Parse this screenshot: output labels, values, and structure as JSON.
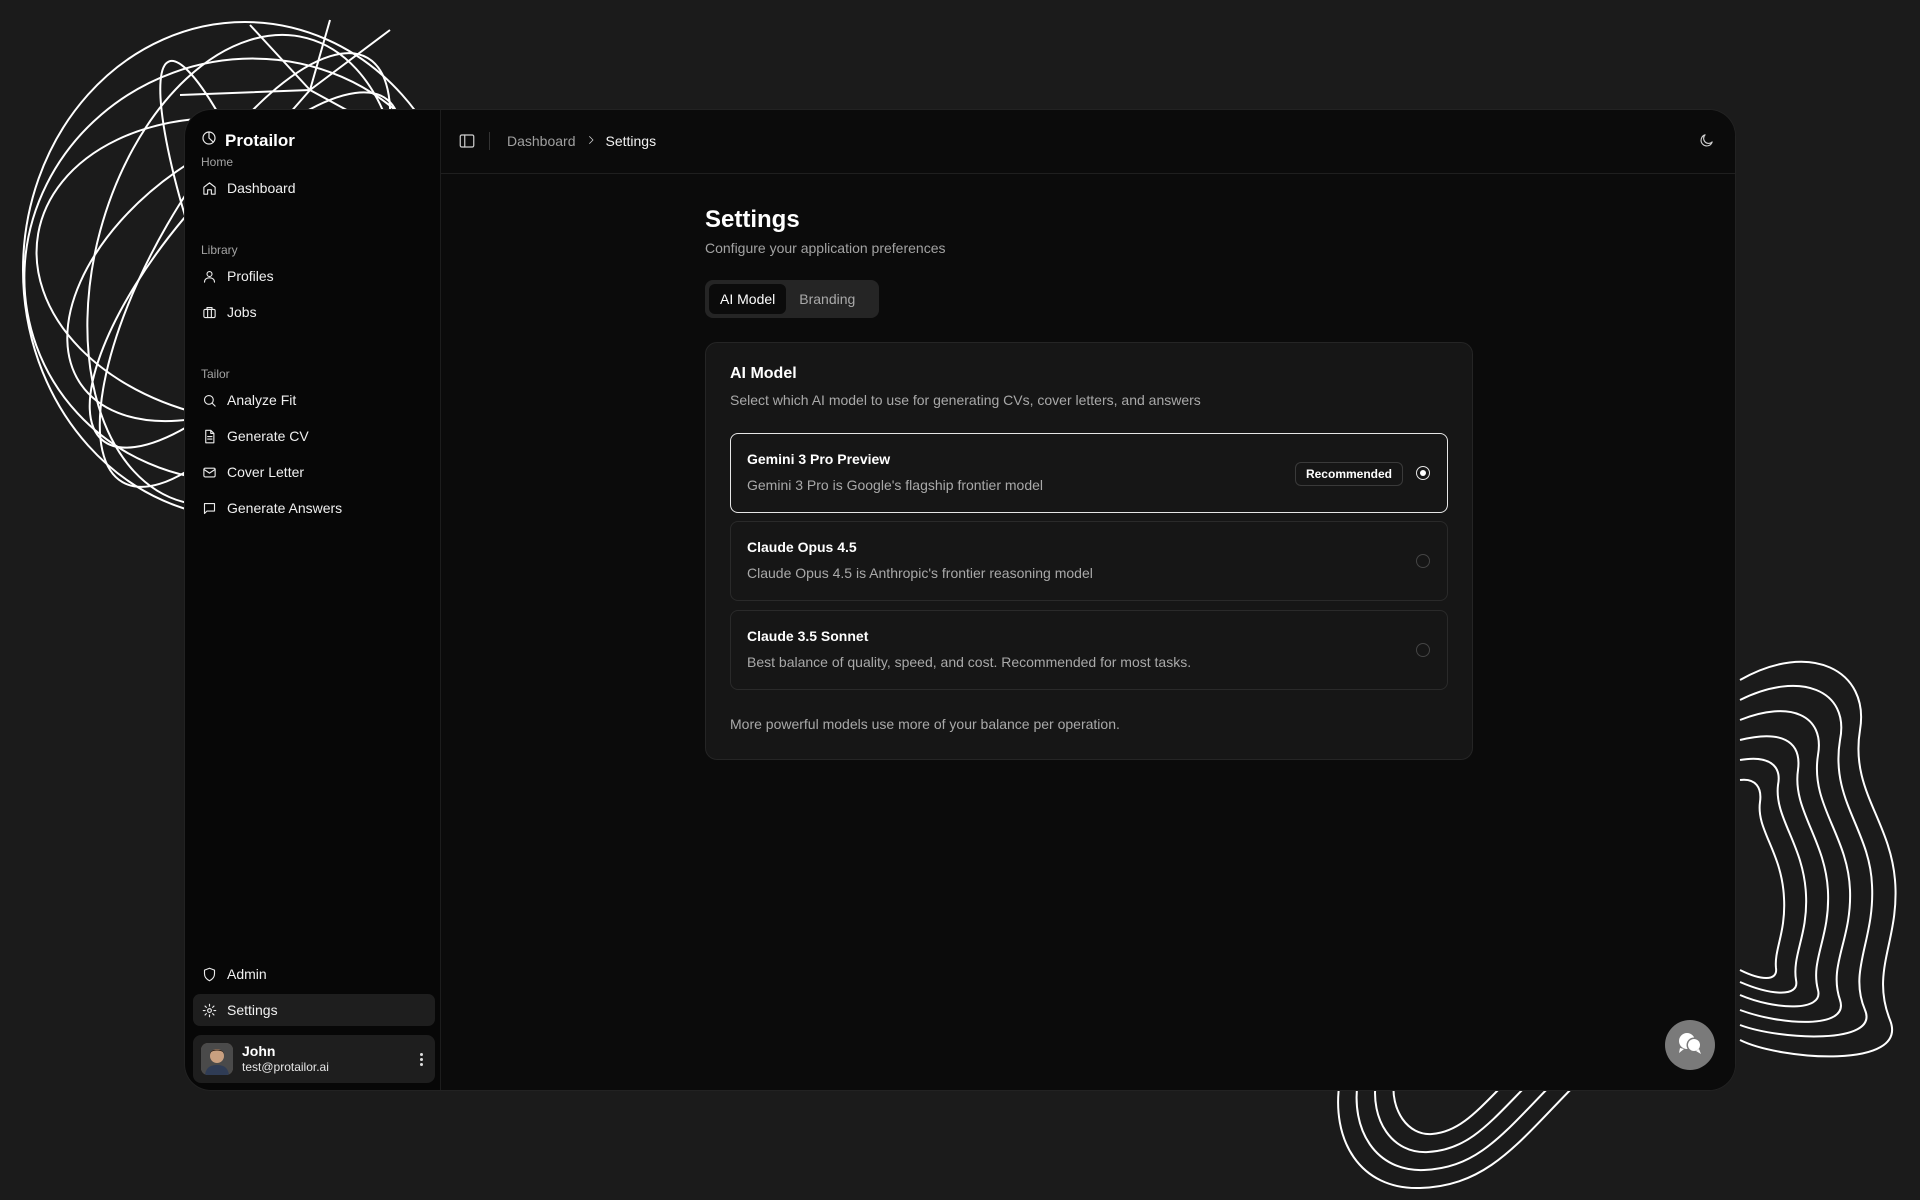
{
  "app": {
    "brand": "Protailor"
  },
  "sidebar": {
    "groups": [
      {
        "label": "Home",
        "items": [
          {
            "label": "Dashboard",
            "icon": "home-icon"
          }
        ]
      },
      {
        "label": "Library",
        "items": [
          {
            "label": "Profiles",
            "icon": "user-icon"
          },
          {
            "label": "Jobs",
            "icon": "briefcase-icon"
          }
        ]
      },
      {
        "label": "Tailor",
        "items": [
          {
            "label": "Analyze Fit",
            "icon": "search-icon"
          },
          {
            "label": "Generate CV",
            "icon": "file-text-icon"
          },
          {
            "label": "Cover Letter",
            "icon": "mail-icon"
          },
          {
            "label": "Generate Answers",
            "icon": "message-square-icon"
          }
        ]
      }
    ],
    "footer_items": [
      {
        "label": "Admin",
        "icon": "shield-icon"
      },
      {
        "label": "Settings",
        "icon": "gear-icon",
        "active": true
      }
    ],
    "user": {
      "name": "John",
      "email": "test@protailor.ai"
    }
  },
  "topbar": {
    "breadcrumb": {
      "parent": "Dashboard",
      "current": "Settings"
    }
  },
  "page": {
    "title": "Settings",
    "subtitle": "Configure your application preferences",
    "tabs": [
      {
        "label": "AI Model",
        "active": true
      },
      {
        "label": "Branding",
        "active": false
      }
    ]
  },
  "ai_model_card": {
    "title": "AI Model",
    "subtitle": "Select which AI model to use for generating CVs, cover letters, and answers",
    "options": [
      {
        "name": "Gemini 3 Pro Preview",
        "description": "Gemini 3 Pro is Google's flagship frontier model",
        "badge": "Recommended",
        "selected": true
      },
      {
        "name": "Claude Opus 4.5",
        "description": "Claude Opus 4.5 is Anthropic's frontier reasoning model",
        "selected": false
      },
      {
        "name": "Claude 3.5 Sonnet",
        "description": "Best balance of quality, speed, and cost. Recommended for most tasks.",
        "selected": false
      }
    ],
    "footnote": "More powerful models use more of your balance per operation."
  },
  "colors": {
    "background": "#1b1b1b",
    "panel": "#0b0b0b",
    "card": "#161616",
    "accent": "#ffffff",
    "muted_text": "#a3a3a3"
  }
}
